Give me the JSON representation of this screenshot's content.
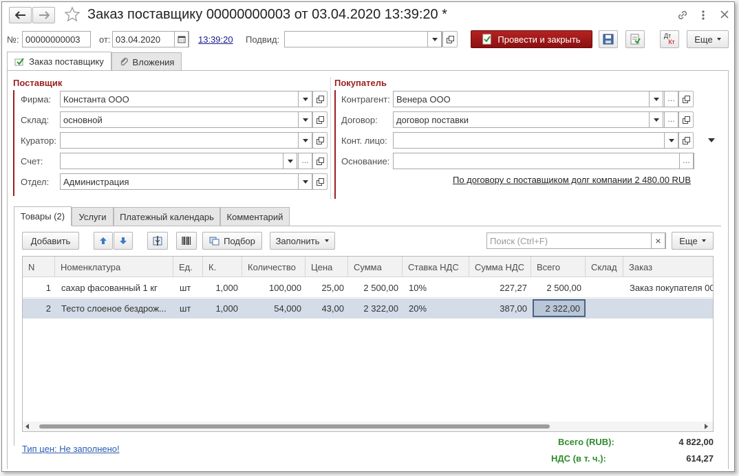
{
  "title": "Заказ поставщику 00000000003 от 03.04.2020 13:39:20 *",
  "header": {
    "number_label": "№:",
    "number": "00000000003",
    "date_label": "от:",
    "date": "03.04.2020",
    "time": "13:39:20",
    "subdiv_label": "Подвид:",
    "subdiv_value": "",
    "post_close_label": "Провести и закрыть",
    "more_label": "Еще",
    "dtkt_top": "Дт",
    "dtkt_bottom": "Кт"
  },
  "form_tabs": [
    {
      "label": "Заказ поставщику"
    },
    {
      "label": "Вложения"
    }
  ],
  "supplier": {
    "title": "Поставщик",
    "firm_label": "Фирма:",
    "firm": "Константа ООО",
    "warehouse_label": "Склад:",
    "warehouse": "основной",
    "curator_label": "Куратор:",
    "curator": "",
    "account_label": "Счет:",
    "account": "",
    "department_label": "Отдел:",
    "department": "Администрация"
  },
  "buyer": {
    "title": "Покупатель",
    "counterparty_label": "Контрагент:",
    "counterparty": "Венера ООО",
    "contract_label": "Договор:",
    "contract": "договор поставки",
    "contact_label": "Конт. лицо:",
    "contact": "",
    "basis_label": "Основание:",
    "basis": "",
    "debt_link": "По договору с поставщиком долг компании 2 480.00 RUB"
  },
  "inner_tabs": [
    {
      "label": "Товары (2)"
    },
    {
      "label": "Услуги"
    },
    {
      "label": "Платежный календарь"
    },
    {
      "label": "Комментарий"
    }
  ],
  "toolbar": {
    "add_label": "Добавить",
    "selection_label": "Подбор",
    "fill_label": "Заполнить",
    "search_placeholder": "Поиск (Ctrl+F)",
    "more_label": "Еще",
    "clear_label": "×"
  },
  "table": {
    "columns": [
      "N",
      "Номенклатура",
      "Ед.",
      "К.",
      "Количество",
      "Цена",
      "Сумма",
      "Ставка НДС",
      "Сумма НДС",
      "Всего",
      "Склад",
      "Заказ"
    ],
    "rows": [
      {
        "n": "1",
        "item": "сахар фасованный 1 кг",
        "unit": "шт",
        "k": "1,000",
        "qty": "100,000",
        "price": "25,00",
        "sum": "2 500,00",
        "vat_rate": "10%",
        "vat_sum": "227,27",
        "total": "2 500,00",
        "wh": "",
        "order": "Заказ покупателя 00"
      },
      {
        "n": "2",
        "item": "Тесто слоеное бездрож...",
        "unit": "шт",
        "k": "1,000",
        "qty": "54,000",
        "price": "43,00",
        "sum": "2 322,00",
        "vat_rate": "20%",
        "vat_sum": "387,00",
        "total": "2 322,00",
        "wh": "",
        "order": ""
      }
    ]
  },
  "footer": {
    "price_type_link": "Тип цен: Не заполнено!",
    "total_label": "Всего (RUB):",
    "total_value": "4 822,00",
    "vat_label": "НДС (в т. ч.):",
    "vat_value": "614,27"
  },
  "colors": {
    "accent_red": "#9b1f1f",
    "post_button": "#a11616",
    "selected_row": "#d3dce7",
    "total_green": "#2e8b2e"
  }
}
